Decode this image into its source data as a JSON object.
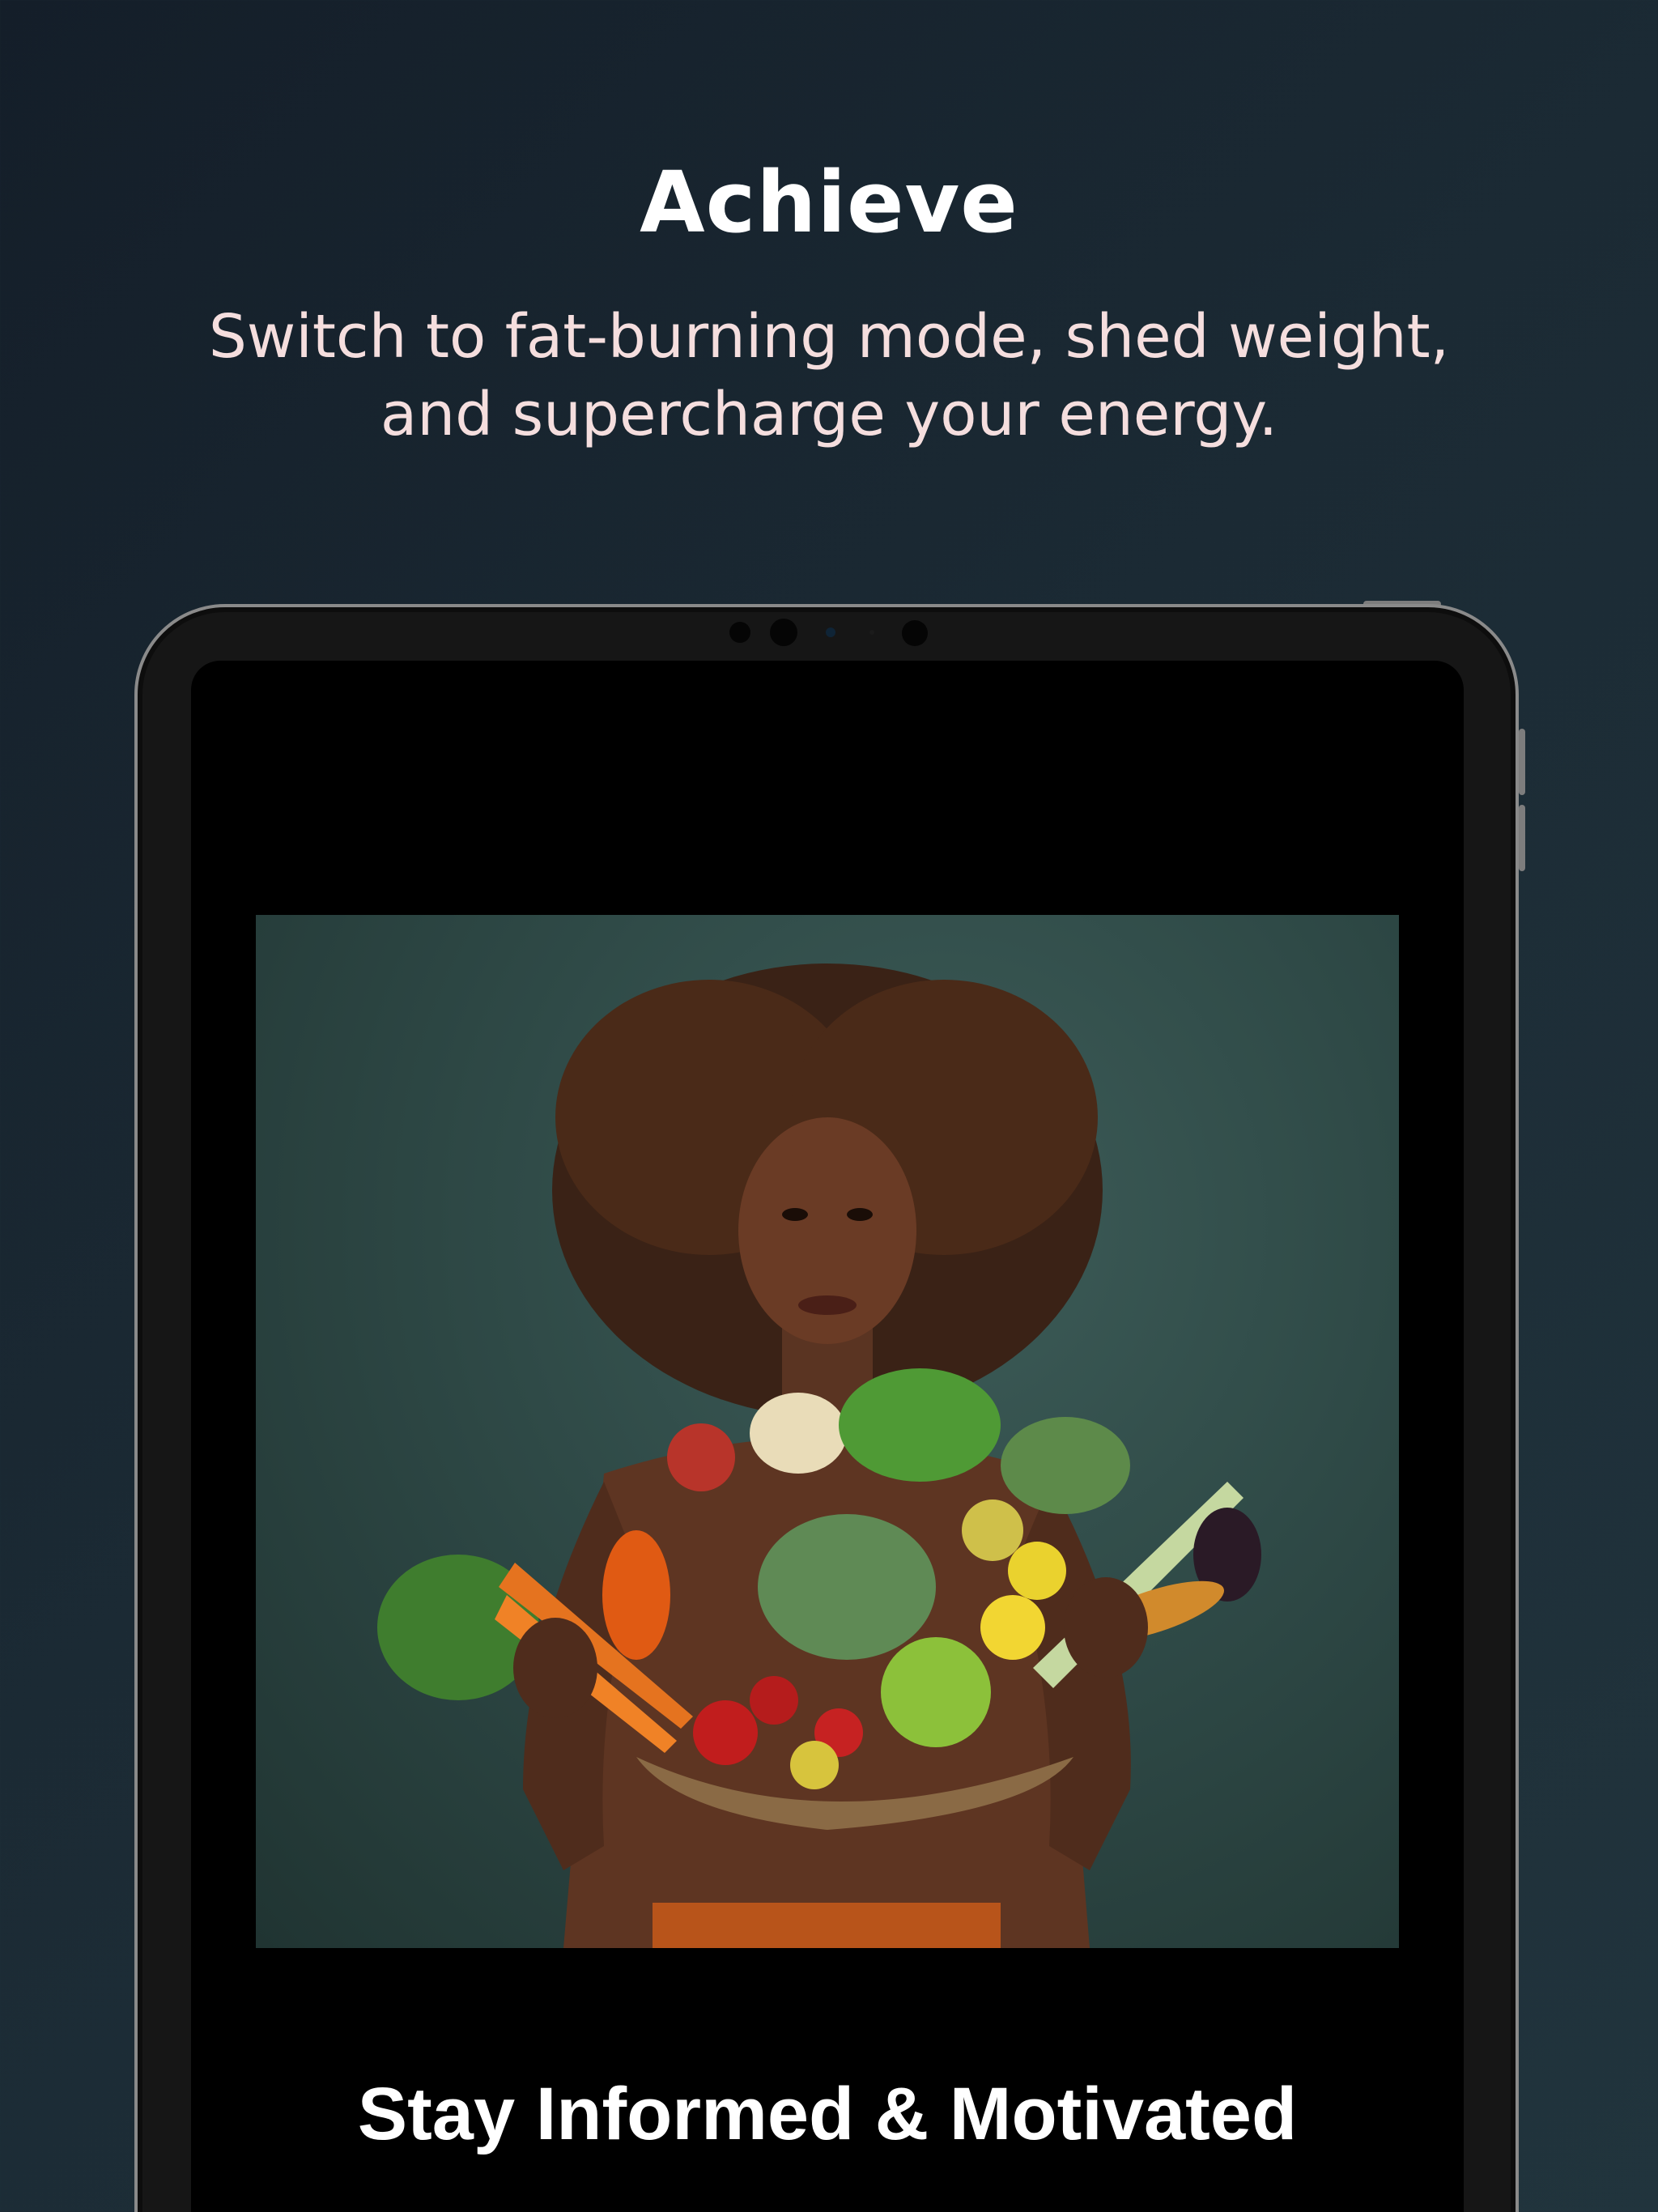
{
  "header": {
    "title": "Achieve",
    "subtitle_line1": "Switch to fat-burning mode, shed weight,",
    "subtitle_line2": "and supercharge your energy."
  },
  "device_screen": {
    "heading": "Stay Informed & Motivated",
    "image": "woman holding basket of fruits and vegetables"
  },
  "colors": {
    "background_start": "#141e29",
    "background_end": "#21343d",
    "title": "#ffffff",
    "subtitle": "#f5dede",
    "device_frame": "#161616",
    "screen": "#000000"
  }
}
